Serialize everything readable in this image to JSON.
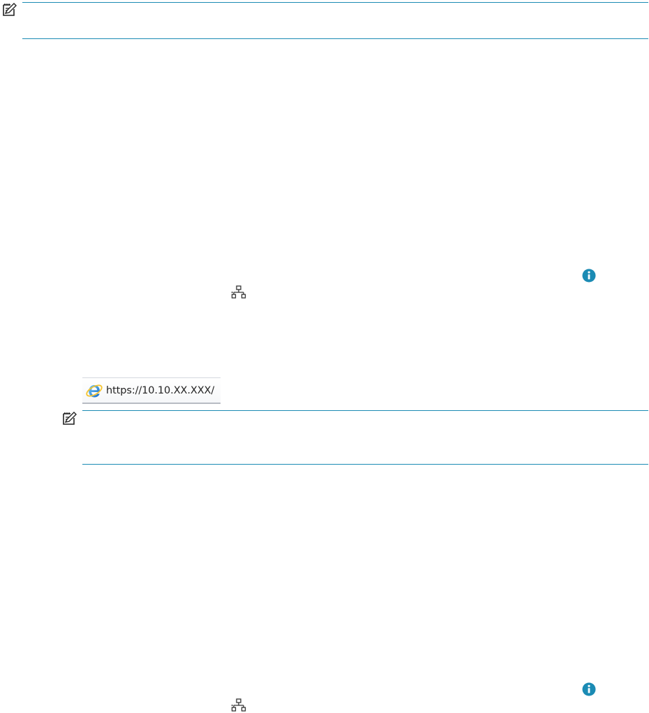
{
  "note_1": {
    "icon": "note-icon",
    "rule_color": "#1b8bb4"
  },
  "step_block_1": {
    "info_icon": "info-icon",
    "info_icon_color": "#1b8bb4",
    "network_icon": "network-icon"
  },
  "address_bar": {
    "browser_icon": "internet-explorer-icon",
    "url": "https://10.10.XX.XXX/"
  },
  "note_2": {
    "icon": "note-icon",
    "rule_color": "#1b8bb4"
  },
  "step_block_2": {
    "info_icon": "info-icon",
    "info_icon_color": "#1b8bb4",
    "network_icon": "network-icon"
  }
}
